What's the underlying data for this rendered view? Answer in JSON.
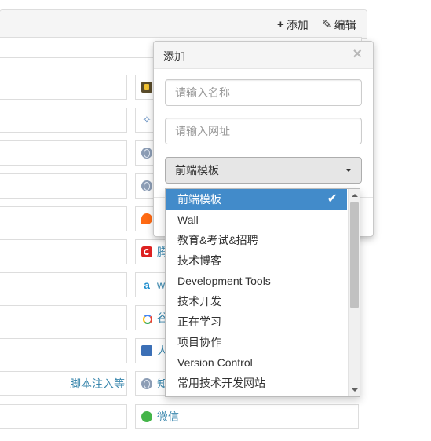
{
  "header": {
    "add_label": "添加",
    "add_glyph": "+",
    "edit_label": "编辑",
    "edit_glyph": "✎"
  },
  "left_links": [
    {
      "text": ""
    },
    {
      "text": ""
    },
    {
      "text": ""
    },
    {
      "text": ""
    },
    {
      "text": ""
    },
    {
      "text": ""
    },
    {
      "text": ""
    },
    {
      "text": ""
    },
    {
      "text": ""
    },
    {
      "text": "脚本注入等"
    },
    {
      "text": ""
    }
  ],
  "right_links": [
    {
      "icon": "bookmark-icon",
      "text": ""
    },
    {
      "icon": "star-icon",
      "text": ""
    },
    {
      "icon": "globe-icon",
      "text": ""
    },
    {
      "icon": "globe-icon",
      "text": ""
    },
    {
      "icon": "orange-logo-icon",
      "text": ""
    },
    {
      "icon": "tencent-icon",
      "text": "腾"
    },
    {
      "icon": "a-logo-icon",
      "text": "w"
    },
    {
      "icon": "google-icon",
      "text": "谷"
    },
    {
      "icon": "people-icon",
      "text": "人"
    },
    {
      "icon": "globe-icon",
      "text": "知"
    },
    {
      "icon": "wechat-icon",
      "text": "微信"
    }
  ],
  "modal": {
    "title": "添加",
    "close_glyph": "×",
    "name_placeholder": "请输入名称",
    "url_placeholder": "请输入网址",
    "selected_category": "前端模板"
  },
  "dropdown": {
    "check_glyph": "✔",
    "options": [
      "前端模板",
      "Wall",
      "教育&考试&招聘",
      "技术博客",
      "Development Tools",
      "技术开发",
      "正在学习",
      "项目协作",
      "Version Control",
      "常用技术开发网站"
    ],
    "active_index": 0
  },
  "colors": {
    "link": "#3a87ad",
    "active_option_bg": "#428bca",
    "heading_bg": "#f5f5f5"
  }
}
